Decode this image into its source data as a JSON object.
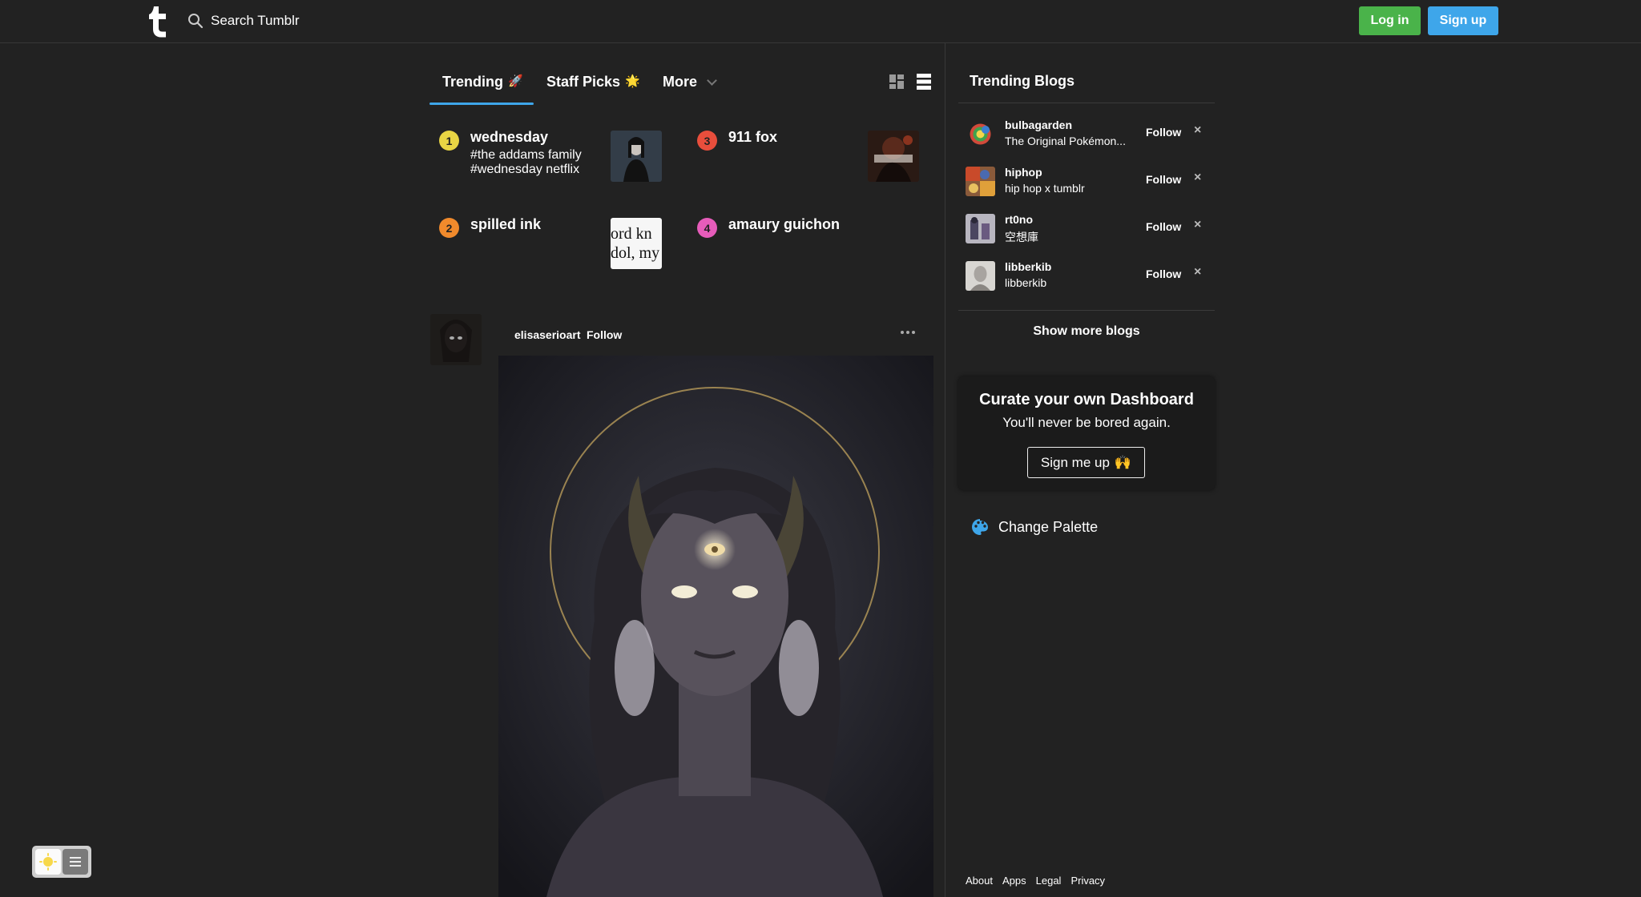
{
  "header": {
    "search_placeholder": "Search Tumblr",
    "login_label": "Log in",
    "signup_label": "Sign up"
  },
  "tabs": [
    {
      "label": "Trending",
      "emoji": "🚀",
      "active": true
    },
    {
      "label": "Staff Picks",
      "emoji": "🌟",
      "active": false
    },
    {
      "label": "More",
      "active": false
    }
  ],
  "trending": [
    {
      "rank": "1",
      "title": "wednesday",
      "tags": [
        "#the addams family",
        "#wednesday netflix"
      ],
      "badge_color": "#e8d544"
    },
    {
      "rank": "2",
      "title": "spilled ink",
      "tags": [],
      "badge_color": "#f08a2c",
      "thumb_text": [
        "ord kn",
        "dol, my"
      ]
    },
    {
      "rank": "3",
      "title": "911 fox",
      "tags": [],
      "badge_color": "#e84e3c"
    },
    {
      "rank": "4",
      "title": "amaury guichon",
      "tags": [],
      "badge_color": "#e65cba"
    }
  ],
  "post": {
    "username": "elisaserioart",
    "follow_label": "Follow"
  },
  "sidebar": {
    "title": "Trending Blogs",
    "blogs": [
      {
        "name": "bulbagarden",
        "description": "The Original Pokémon...",
        "follow_label": "Follow",
        "dismiss": "×"
      },
      {
        "name": "hiphop",
        "description": "hip hop x tumblr",
        "follow_label": "Follow",
        "dismiss": "×"
      },
      {
        "name": "rt0no",
        "description": "空想庫",
        "follow_label": "Follow",
        "dismiss": "×"
      },
      {
        "name": "libberkib",
        "description": "libberkib",
        "follow_label": "Follow",
        "dismiss": "×"
      }
    ],
    "show_more_label": "Show more blogs",
    "curate": {
      "title": "Curate your own Dashboard",
      "subtitle": "You'll never be bored again.",
      "button_label": "Sign me up",
      "button_emoji": "🙌"
    },
    "palette_label": "Change Palette"
  },
  "footer": {
    "links": [
      "About",
      "Apps",
      "Legal",
      "Privacy"
    ]
  },
  "colors": {
    "background": "#222222",
    "login_green": "#4ab34a",
    "signup_blue": "#3ea6ea",
    "tab_accent": "#3ea6ea"
  }
}
